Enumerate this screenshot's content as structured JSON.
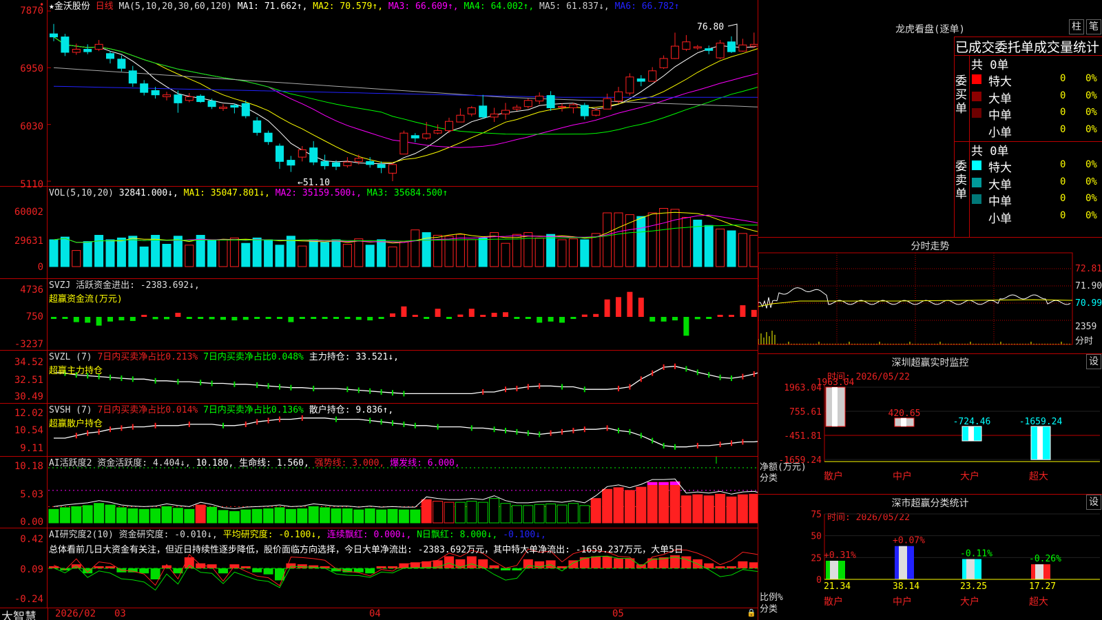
{
  "candle": {
    "ticks": [
      "7870",
      "6950",
      "6030",
      "5110"
    ],
    "stock": "★金沃股份",
    "period": "日线",
    "ma_label": "MA(5,10,20,30,60,120)",
    "ma1": "MA1: 71.662↑,",
    "ma2": "MA2: 70.579↑,",
    "ma3": "MA3: 66.609↑,",
    "ma4": "MA4: 64.002↑,",
    "ma5": "MA5: 61.837↓,",
    "ma6": "MA6: 66.782↑",
    "high_note": "76.80",
    "low_note": "←51.10"
  },
  "vol": {
    "ticks": [
      "60002",
      "29631",
      "0"
    ],
    "label": "VOL(5,10,20)",
    "v": "32841.000↓,",
    "ma1": "MA1: 35047.801↓,",
    "ma2": "MA2: 35159.500↓,",
    "ma3": "MA3: 35684.500↑"
  },
  "svzj": {
    "ticks": [
      "4736",
      "750",
      "-3237"
    ],
    "label": "SVZJ  活跃资金进出: -2383.692↓,",
    "sub": "超赢资金流(万元)"
  },
  "svzl": {
    "ticks": [
      "34.52",
      "32.51",
      "30.49"
    ],
    "l1": "SVZL (7)",
    "l2": "7日内买卖净占比0.213%",
    "l3": "7日内买卖净占比0.048%",
    "l4": "主力持仓: 33.521↓,",
    "sub": "超赢主力持仓"
  },
  "svsh": {
    "ticks": [
      "12.02",
      "10.54",
      "9.11"
    ],
    "l1": "SVSH (7)",
    "l2": "7日内买卖净占比0.014%",
    "l3": "7日内买卖净占比0.136%",
    "l4": "散户持仓: 9.836↑,",
    "sub": "超赢散户持仓"
  },
  "act": {
    "ticks": [
      "10.18",
      "5.03",
      "0.00"
    ],
    "l1": "AI活跃度2 资金活跃度: 4.404↓,",
    "l2": "10.180, 生命线: 1.560,",
    "l3": "强势线: 3.000,",
    "l4": "爆发线: 6.000,"
  },
  "res": {
    "ticks": [
      "0.42",
      "0.09",
      "-0.24"
    ],
    "l1": "AI研究度2(10) 资金研究度: -0.010↓,",
    "l2": "平均研究度: -0.100↓,",
    "l3": "连续飘红: 0.000↓,",
    "l4": "N日飘红: 8.000↓,",
    "l5": "-0.100↓,",
    "summary": "总体看前几日大资金有关注，但近日持续性逐步降低，股价面临方向选择，今日大单净流出: -2383.692万元，其中特大单净流出: -1659.237万元，大单5日"
  },
  "footer": {
    "brand": "大智慧",
    "d0": "2026/02",
    "d1": "03",
    "d2": "04",
    "d3": "05"
  },
  "dragon": {
    "title": "龙虎看盘(逐单)",
    "btn1": "柱",
    "btn2": "笔",
    "header": "已成交委托单成交量统计",
    "buy_label": "委买单",
    "sell_label": "委卖单",
    "buy_total": "共 0单",
    "sell_total": "共 0单",
    "buy_rows": [
      {
        "label": "特大",
        "value": "0",
        "pct": "0%",
        "color": "#ff0000"
      },
      {
        "label": "大单",
        "value": "0",
        "pct": "0%",
        "color": "#8b0000"
      },
      {
        "label": "中单",
        "value": "0",
        "pct": "0%",
        "color": "#6e0000"
      },
      {
        "label": "小单",
        "value": "0",
        "pct": "0%",
        "color": ""
      }
    ],
    "sell_rows": [
      {
        "label": "特大",
        "value": "0",
        "pct": "0%",
        "color": "#00ffff"
      },
      {
        "label": "大单",
        "value": "0",
        "pct": "0%",
        "color": "#009a9a"
      },
      {
        "label": "中单",
        "value": "0",
        "pct": "0%",
        "color": "#007878"
      },
      {
        "label": "小单",
        "value": "0",
        "pct": "0%",
        "color": ""
      }
    ]
  },
  "intraday": {
    "title": "分时走势",
    "ticks": [
      "72.81",
      "71.90",
      "70.99"
    ],
    "vol_tick": "2359",
    "vol_label": "分时"
  },
  "monitor": {
    "title": "深圳超赢实时监控",
    "btn": "设",
    "time": "时间: 2026/05/22",
    "ylabel": "净额(万元)",
    "xlabel": "分类"
  },
  "classify": {
    "title": "深市超赢分类统计",
    "btn": "设",
    "time": "时间: 2026/05/22",
    "ylabel": "比例%",
    "xlabel": "分类"
  },
  "chart_data": [
    {
      "type": "candlestick",
      "title": "★金沃股份 日线",
      "ylim": [
        5110,
        7870
      ],
      "x": [
        "2026/02",
        "03",
        "04",
        "05"
      ],
      "high_marker": 76.8,
      "low_marker": 51.1,
      "ohlc": [
        [
          75.0,
          74.5,
          76.6,
          73.8
        ],
        [
          74.5,
          72.0,
          75.0,
          71.4
        ],
        [
          72.0,
          72.5,
          73.4,
          71.6
        ],
        [
          72.5,
          72.1,
          73.3,
          71.7
        ],
        [
          72.5,
          73.3,
          74.0,
          72.2
        ],
        [
          71.8,
          71.0,
          72.2,
          70.2
        ],
        [
          70.9,
          69.4,
          71.5,
          68.9
        ],
        [
          69.0,
          67.0,
          69.8,
          66.4
        ],
        [
          66.9,
          65.5,
          67.5,
          65.0
        ],
        [
          65.8,
          65.1,
          66.4,
          64.5
        ],
        [
          64.8,
          65.1,
          65.6,
          64.2
        ],
        [
          65.1,
          63.8,
          65.8,
          62.2
        ],
        [
          64.2,
          64.8,
          65.4,
          63.9
        ],
        [
          64.9,
          64.0,
          65.2,
          63.8
        ],
        [
          64.1,
          63.2,
          64.5,
          62.8
        ],
        [
          62.9,
          63.1,
          63.6,
          62.5
        ],
        [
          63.4,
          63.1,
          63.7,
          62.1
        ],
        [
          63.7,
          61.7,
          64.2,
          61.3
        ],
        [
          60.9,
          59.0,
          61.5,
          58.5
        ],
        [
          58.9,
          57.5,
          59.3,
          57.0
        ],
        [
          56.8,
          54.3,
          57.2,
          53.1
        ],
        [
          54.5,
          53.7,
          55.2,
          52.6
        ],
        [
          55.0,
          56.2,
          56.8,
          54.3
        ],
        [
          56.5,
          54.2,
          57.6,
          53.7
        ],
        [
          54.3,
          53.6,
          55.4,
          53.0
        ],
        [
          54.1,
          53.5,
          54.5,
          52.9
        ],
        [
          53.6,
          54.2,
          55.0,
          53.3
        ],
        [
          54.3,
          54.8,
          55.4,
          53.8
        ],
        [
          54.3,
          53.8,
          55.0,
          53.3
        ],
        [
          53.8,
          53.3,
          54.3,
          52.4
        ],
        [
          52.4,
          53.8,
          54.1,
          51.1
        ],
        [
          55.5,
          58.9,
          59.3,
          55.5
        ],
        [
          58.5,
          58.1,
          58.9,
          57.4
        ],
        [
          58.1,
          58.8,
          60.7,
          57.8
        ],
        [
          58.9,
          59.3,
          60.3,
          58.7
        ],
        [
          59.3,
          60.8,
          61.4,
          58.9
        ],
        [
          60.7,
          61.8,
          62.9,
          60.7
        ],
        [
          62.0,
          63.0,
          63.3,
          61.6
        ],
        [
          63.3,
          61.5,
          65.1,
          61.2
        ],
        [
          61.5,
          62.0,
          63.0,
          60.7
        ],
        [
          62.0,
          62.6,
          63.8,
          61.1
        ],
        [
          62.8,
          63.1,
          63.5,
          62.5
        ],
        [
          63.2,
          64.2,
          64.5,
          62.9
        ],
        [
          64.1,
          64.9,
          65.5,
          63.6
        ],
        [
          65.0,
          63.0,
          65.7,
          62.5
        ],
        [
          63.1,
          63.2,
          63.7,
          62.4
        ],
        [
          63.0,
          63.5,
          63.8,
          62.1
        ],
        [
          63.4,
          61.7,
          63.8,
          61.1
        ],
        [
          61.8,
          62.6,
          63.0,
          61.6
        ],
        [
          62.8,
          64.5,
          65.3,
          62.8
        ],
        [
          64.1,
          65.6,
          66.4,
          63.7
        ],
        [
          65.4,
          68.0,
          68.6,
          65.0
        ],
        [
          67.7,
          67.3,
          68.3,
          66.5
        ],
        [
          67.3,
          69.0,
          69.6,
          67.3
        ],
        [
          69.5,
          71.0,
          71.5,
          69.3
        ],
        [
          71.0,
          73.0,
          75.2,
          70.9
        ],
        [
          72.5,
          73.7,
          74.8,
          72.2
        ],
        [
          72.7,
          72.9,
          73.2,
          72.4
        ],
        [
          72.6,
          72.3,
          73.1,
          71.7
        ],
        [
          71.1,
          73.5,
          74.0,
          70.9
        ],
        [
          73.7,
          72.1,
          74.6,
          71.9
        ],
        [
          72.2,
          73.2,
          74.2,
          72.1
        ],
        [
          73.0,
          73.3,
          75.2,
          72.7
        ],
        [
          73.5,
          75.0,
          76.3,
          73.1
        ],
        [
          74.9,
          74.3,
          75.3,
          73.6
        ],
        [
          74.4,
          73.6,
          76.8,
          73.6
        ],
        [
          73.8,
          73.4,
          74.2,
          71.8
        ]
      ]
    },
    {
      "type": "bar",
      "title": "VOL(5,10,20)",
      "ylim": [
        0,
        60002
      ],
      "values": [
        30000,
        33000,
        18000,
        28000,
        35000,
        30000,
        32000,
        34000,
        22000,
        35000,
        25000,
        34000,
        24000,
        35000,
        30000,
        30000,
        32000,
        26000,
        32000,
        30000,
        24000,
        34000,
        23000,
        30000,
        27000,
        30000,
        25000,
        31000,
        24000,
        30000,
        22000,
        28000,
        41000,
        38000,
        35000,
        34000,
        36000,
        30000,
        32000,
        38000,
        26000,
        36000,
        38000,
        32000,
        36000,
        30000,
        31000,
        30000,
        37000,
        60000,
        60000,
        58000,
        56000,
        60002,
        65000,
        64000,
        55000,
        52000,
        46000,
        42000,
        40000,
        37000,
        35000,
        32000,
        33000,
        33500,
        32841
      ],
      "rising": [
        false,
        false,
        true,
        false,
        false,
        false,
        false,
        false,
        false,
        false,
        false,
        false,
        true,
        false,
        false,
        true,
        true,
        false,
        false,
        false,
        false,
        false,
        true,
        false,
        false,
        false,
        true,
        true,
        false,
        false,
        true,
        true,
        true,
        false,
        true,
        true,
        true,
        true,
        false,
        true,
        true,
        true,
        true,
        true,
        false,
        true,
        true,
        false,
        true,
        true,
        true,
        true,
        false,
        true,
        true,
        true,
        true,
        false,
        false,
        true,
        false,
        true,
        true,
        true,
        false,
        false,
        false
      ],
      "lines": [
        "MA1",
        "MA2",
        "MA3"
      ]
    },
    {
      "type": "bar",
      "title": "超赢资金流(万元)",
      "ylim": [
        -3237,
        4736
      ],
      "values": [
        -100,
        -300,
        -900,
        -1000,
        -1500,
        -800,
        -600,
        -700,
        200,
        -400,
        -400,
        700,
        -200,
        -300,
        -400,
        -500,
        -600,
        -500,
        -300,
        -200,
        -100,
        -900,
        -200,
        -300,
        -300,
        -300,
        -200,
        -500,
        -600,
        -300,
        600,
        1800,
        300,
        -200,
        1400,
        -300,
        400,
        1400,
        300,
        700,
        800,
        -300,
        -200,
        -1000,
        -800,
        -1000,
        -300,
        400,
        500,
        3000,
        3400,
        4300,
        3300,
        -800,
        -800,
        -600,
        -3237,
        -400,
        -200,
        200,
        200,
        2000,
        1200,
        -1000,
        1600,
        -2383.692
      ]
    },
    {
      "type": "line",
      "title": "超赢主力持仓",
      "ylim": [
        30.49,
        34.52
      ],
      "values": [
        33.6,
        33.5,
        33.3,
        33.2,
        33.1,
        33.0,
        32.9,
        32.8,
        32.8,
        32.6,
        32.6,
        32.5,
        32.5,
        32.4,
        32.3,
        32.3,
        32.2,
        32.2,
        32.1,
        32.0,
        31.9,
        31.8,
        31.8,
        31.7,
        31.7,
        31.7,
        31.6,
        31.5,
        31.4,
        31.3,
        31.2,
        31.1,
        31.1,
        31.1,
        31.1,
        31.1,
        31.1,
        31.1,
        31.3,
        31.3,
        31.6,
        31.7,
        31.9,
        32.0,
        32.0,
        31.9,
        31.9,
        31.6,
        31.6,
        31.6,
        31.7,
        31.9,
        32.8,
        33.5,
        34.2,
        34.3,
        34.0,
        33.6,
        33.3,
        33.0,
        32.9,
        33.1,
        33.4,
        33.8,
        34.2,
        33.6,
        33.521
      ]
    },
    {
      "type": "line",
      "title": "超赢散户持仓",
      "ylim": [
        9.11,
        12.02
      ],
      "values": [
        10.1,
        10.1,
        10.3,
        10.5,
        10.6,
        10.8,
        10.9,
        11.0,
        11.0,
        11.1,
        11.1,
        11.1,
        11.2,
        11.2,
        11.2,
        11.1,
        11.1,
        11.2,
        11.4,
        11.5,
        11.6,
        11.6,
        11.7,
        11.7,
        11.7,
        11.6,
        11.6,
        11.6,
        11.5,
        11.4,
        11.3,
        11.2,
        11.1,
        11.1,
        11.0,
        11.0,
        11.0,
        10.9,
        10.9,
        10.8,
        10.7,
        10.6,
        10.5,
        10.4,
        10.5,
        10.6,
        10.7,
        10.8,
        10.8,
        10.9,
        10.7,
        10.6,
        10.3,
        9.9,
        9.5,
        9.4,
        9.4,
        9.5,
        9.5,
        9.6,
        9.7,
        9.8,
        9.8,
        9.9,
        10.0,
        10.1,
        9.836
      ]
    },
    {
      "type": "bar",
      "title": "AI活跃度2 资金活跃度",
      "ylim": [
        0,
        10.18
      ],
      "values": [
        2.5,
        2.8,
        3.0,
        3.2,
        3.6,
        3.3,
        2.8,
        2.6,
        2.5,
        2.6,
        3.0,
        2.7,
        2.5,
        3.3,
        2.9,
        2.3,
        2.1,
        2.4,
        2.5,
        2.6,
        2.8,
        2.5,
        2.6,
        3.0,
        2.8,
        2.6,
        2.6,
        2.4,
        2.6,
        2.4,
        2.5,
        2.4,
        2.4,
        4.3,
        4.0,
        3.8,
        3.8,
        4.0,
        3.8,
        4.5,
        3.6,
        3.2,
        3.2,
        3.4,
        3.5,
        3.3,
        3.6,
        3.2,
        4.5,
        6.2,
        6.5,
        6.0,
        6.6,
        7.5,
        7.5,
        7.6,
        5.0,
        5.2,
        5.0,
        5.3,
        4.8,
        5.2,
        5.3,
        4.8,
        5.0,
        5.2,
        5.3,
        6.0,
        4.404
      ],
      "life_line": 1.56,
      "strong_line": 3.0,
      "burst_line": 6.0
    },
    {
      "type": "bar",
      "title": "AI研究度2(10)",
      "ylim": [
        -0.24,
        0.42
      ],
      "values": [
        0.02,
        -0.02,
        0.04,
        -0.05,
        0.01,
        0.0,
        -0.04,
        -0.04,
        -0.05,
        -0.11,
        0.03,
        -0.05,
        0.11,
        0.05,
        0.04,
        -0.05,
        0.04,
        0.0,
        -0.04,
        -0.06,
        -0.12,
        0.05,
        0.04,
        0.03,
        0.02,
        -0.03,
        -0.04,
        -0.04,
        -0.05,
        0.0,
        0.0,
        0.05,
        0.06,
        0.07,
        0.08,
        0.12,
        0.09,
        0.12,
        0.09,
        0.03,
        -0.02,
        -0.01,
        0.09,
        0.07,
        0.08,
        0.02,
        0.08,
        0.11,
        0.12,
        0.12,
        0.1,
        0.1,
        0.04,
        0.1,
        0.11,
        0.13,
        0.12,
        0.09,
        0.05,
        0.0,
        0.02,
        0.07,
        0.06,
        0.05,
        -0.01
      ],
      "lines": [
        "资金研究度",
        "平均研究度"
      ]
    },
    {
      "type": "line",
      "title": "分时走势",
      "ylim": [
        70.99,
        72.81
      ],
      "ticks": [
        72.81,
        71.9,
        70.99
      ],
      "vol_tick": 2359
    },
    {
      "type": "bar",
      "title": "深圳超赢实时监控",
      "ylabel": "净额(万元)",
      "xlabel": "分类",
      "ticks": [
        1963.04,
        755.61,
        -451.81,
        -1659.24
      ],
      "ylim": [
        -1659.24,
        1963.04
      ],
      "categories": [
        "散户",
        "中户",
        "大户",
        "超大"
      ],
      "values": [
        1963.04,
        420.65,
        -724.46,
        -1659.24
      ],
      "labels": [
        "1963.04",
        "420.65",
        "-724.46",
        "-1659.24"
      ]
    },
    {
      "type": "bar",
      "title": "深市超赢分类统计",
      "ylabel": "比例%",
      "xlabel": "分类",
      "ticks": [
        75,
        50,
        25,
        0
      ],
      "ylim": [
        0,
        75
      ],
      "categories": [
        "散户",
        "中户",
        "大户",
        "超大"
      ],
      "values": [
        21.34,
        38.14,
        23.25,
        17.27
      ],
      "change": [
        "+0.31%",
        "+0.07%",
        "-0.11%",
        "-0.26%"
      ]
    }
  ]
}
